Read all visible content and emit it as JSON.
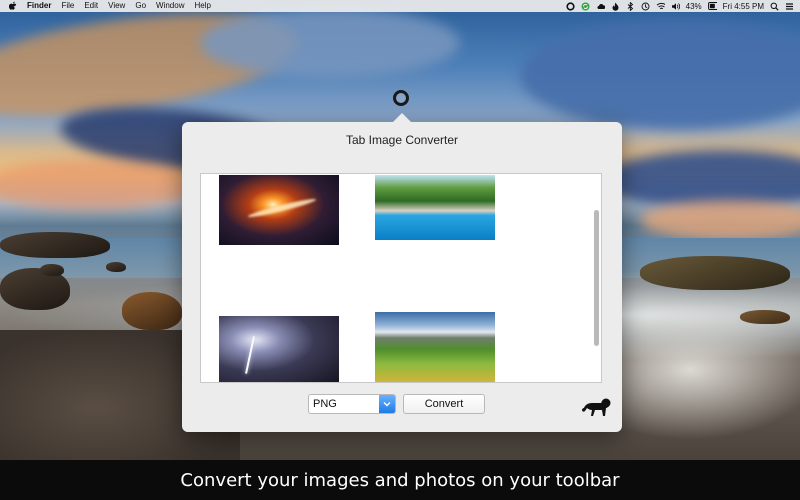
{
  "menubar": {
    "apple_icon": "apple-logo",
    "items": [
      "Finder",
      "File",
      "Edit",
      "View",
      "Go",
      "Window",
      "Help"
    ],
    "status_icons": [
      "circle-app-icon",
      "sync-icon",
      "cloud-icon",
      "fire-icon",
      "bluetooth-icon",
      "history-icon",
      "wifi-icon",
      "volume-icon"
    ],
    "battery_percent": "43%",
    "clock": "Fri 4:55 PM",
    "right_icons": [
      "search-icon",
      "list-icon"
    ]
  },
  "popover": {
    "title": "Tab Image Converter",
    "images": [
      {
        "name": "nebula"
      },
      {
        "name": "pool"
      },
      {
        "name": "storm"
      },
      {
        "name": "valley"
      }
    ],
    "format": {
      "selected": "PNG"
    },
    "convert_label": "Convert",
    "logo_icon": "lion-icon"
  },
  "caption": "Convert your images and photos on your toolbar",
  "colors": {
    "accent": "#1f7ae6",
    "popover_bg": "#ececec",
    "caption_bg": "#0b0b0b"
  }
}
